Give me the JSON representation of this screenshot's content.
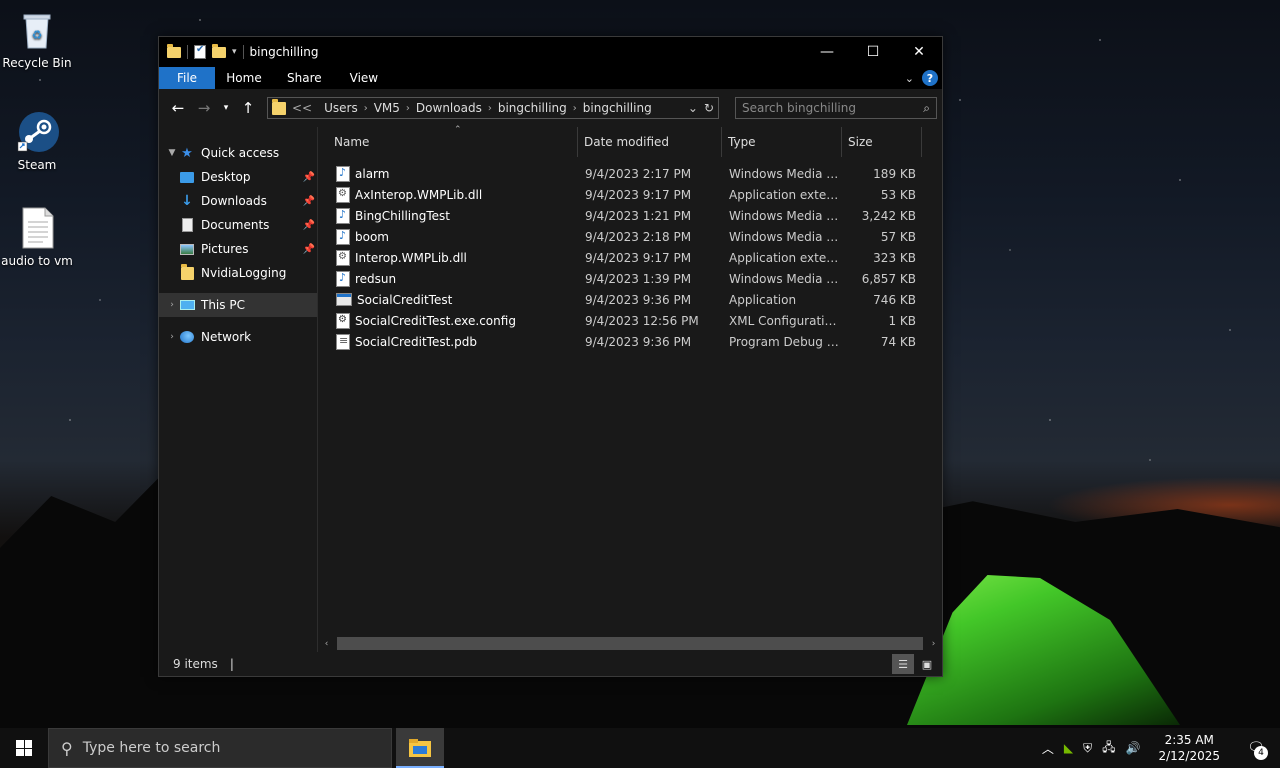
{
  "desktop": {
    "icons": [
      {
        "label": "Recycle Bin",
        "icon": "recycle-bin-icon"
      },
      {
        "label": "Steam",
        "icon": "steam-icon"
      },
      {
        "label": "audio to vm",
        "icon": "text-file-icon"
      }
    ]
  },
  "window": {
    "title": "bingchilling",
    "controls": {
      "minimize": "—",
      "maximize": "☐",
      "close": "✕"
    }
  },
  "ribbon": {
    "tabs": [
      "File",
      "Home",
      "Share",
      "View"
    ]
  },
  "address": {
    "prefix": "<<",
    "crumbs": [
      "Users",
      "VM5",
      "Downloads",
      "bingchilling",
      "bingchilling"
    ]
  },
  "search": {
    "placeholder": "Search bingchilling"
  },
  "nav": {
    "items": [
      {
        "label": "Quick access",
        "icon": "star-icon",
        "expanded": true
      },
      {
        "label": "Desktop",
        "icon": "desktop-folder-icon",
        "pinned": true
      },
      {
        "label": "Downloads",
        "icon": "download-arrow-icon",
        "pinned": true
      },
      {
        "label": "Documents",
        "icon": "documents-icon",
        "pinned": true
      },
      {
        "label": "Pictures",
        "icon": "pictures-icon",
        "pinned": true
      },
      {
        "label": "NvidiaLogging",
        "icon": "folder-icon",
        "pinned": false
      },
      {
        "label": "This PC",
        "icon": "pc-icon",
        "selected": true
      },
      {
        "label": "Network",
        "icon": "network-icon"
      }
    ]
  },
  "columns": {
    "name": "Name",
    "date": "Date modified",
    "type": "Type",
    "size": "Size"
  },
  "files": [
    {
      "name": "alarm",
      "date": "9/4/2023 2:17 PM",
      "type": "Windows Media A...",
      "size": "189 KB",
      "icon": "media"
    },
    {
      "name": "AxInterop.WMPLib.dll",
      "date": "9/4/2023 9:17 PM",
      "type": "Application exten...",
      "size": "53 KB",
      "icon": "dll"
    },
    {
      "name": "BingChillingTest",
      "date": "9/4/2023 1:21 PM",
      "type": "Windows Media A...",
      "size": "3,242 KB",
      "icon": "media"
    },
    {
      "name": "boom",
      "date": "9/4/2023 2:18 PM",
      "type": "Windows Media A...",
      "size": "57 KB",
      "icon": "media"
    },
    {
      "name": "Interop.WMPLib.dll",
      "date": "9/4/2023 9:17 PM",
      "type": "Application exten...",
      "size": "323 KB",
      "icon": "dll"
    },
    {
      "name": "redsun",
      "date": "9/4/2023 1:39 PM",
      "type": "Windows Media A...",
      "size": "6,857 KB",
      "icon": "media"
    },
    {
      "name": "SocialCreditTest",
      "date": "9/4/2023 9:36 PM",
      "type": "Application",
      "size": "746 KB",
      "icon": "app"
    },
    {
      "name": "SocialCreditTest.exe.config",
      "date": "9/4/2023 12:56 PM",
      "type": "XML Configuratio...",
      "size": "1 KB",
      "icon": "cfg"
    },
    {
      "name": "SocialCreditTest.pdb",
      "date": "9/4/2023 9:36 PM",
      "type": "Program Debug D...",
      "size": "74 KB",
      "icon": "pdb"
    }
  ],
  "status": {
    "items": "9 items",
    "sep": "|"
  },
  "taskbar": {
    "search_placeholder": "Type here to search",
    "time": "2:35 AM",
    "date": "2/12/2025",
    "notifications": "4"
  }
}
